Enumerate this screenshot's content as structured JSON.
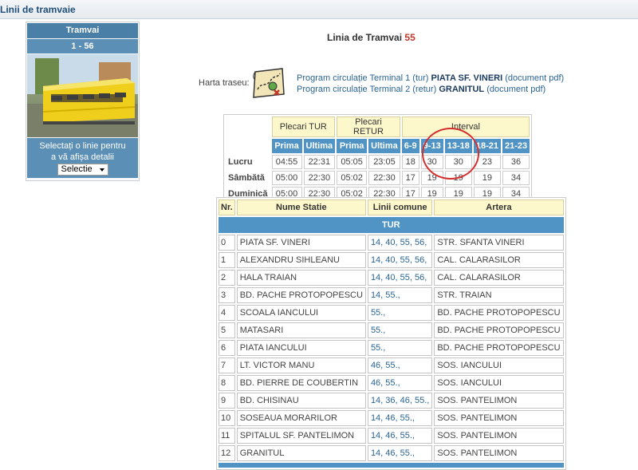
{
  "page": {
    "title": "Linii de tramvaie"
  },
  "sidebar": {
    "header": "Tramvai",
    "range": "1 - 56",
    "select_prompt_line1": "Selectați o linie pentru",
    "select_prompt_line2": "a vă afișa detalii",
    "select_value": "Selectie"
  },
  "main": {
    "line_prefix": "Linia de Tramvai",
    "line_number": "55",
    "map_label": "Harta traseu:",
    "program1": {
      "prefix": "Program circulație Terminal 1 (tur)",
      "terminal": "PIATA SF. VINERI",
      "suffix": "(document pdf)"
    },
    "program2": {
      "prefix": "Program circulație Terminal 2 (retur)",
      "terminal": "GRANITUL",
      "suffix": "(document pdf)"
    }
  },
  "schedule": {
    "group_headers": [
      "Plecari TUR",
      "Plecari RETUR",
      "Interval"
    ],
    "sub_headers": [
      "Prima",
      "Ultima",
      "Prima",
      "Ultima",
      "6-9",
      "9-13",
      "13-18",
      "18-21",
      "21-23"
    ],
    "rows": [
      {
        "day": "Lucru",
        "cells": [
          "04:55",
          "22:31",
          "05:05",
          "23:05",
          "18",
          "30",
          "30",
          "23",
          "36"
        ]
      },
      {
        "day": "Sâmbătă",
        "cells": [
          "05:00",
          "22:30",
          "05:02",
          "22:30",
          "17",
          "19",
          "19",
          "19",
          "34"
        ]
      },
      {
        "day": "Duminică",
        "cells": [
          "05:00",
          "22:30",
          "05:02",
          "22:30",
          "17",
          "19",
          "19",
          "19",
          "34"
        ]
      }
    ],
    "highlight_color": "#d32f2f"
  },
  "stations": {
    "headers": [
      "Nr.",
      "Nume Statie",
      "Linii comune",
      "Artera"
    ],
    "section": "TUR",
    "rows": [
      {
        "nr": "0",
        "name": "PIATA SF. VINERI",
        "lines": "14, 40, 55, 56,",
        "artery": "STR. SFANTA VINERI"
      },
      {
        "nr": "1",
        "name": "ALEXANDRU SIHLEANU",
        "lines": "14, 40, 55, 56,",
        "artery": "CAL. CALARASILOR"
      },
      {
        "nr": "2",
        "name": "HALA TRAIAN",
        "lines": "14, 40, 55, 56,",
        "artery": "CAL. CALARASILOR"
      },
      {
        "nr": "3",
        "name": "BD. PACHE PROTOPOPESCU",
        "lines": "14, 55.,",
        "artery": "STR. TRAIAN"
      },
      {
        "nr": "4",
        "name": "SCOALA IANCULUI",
        "lines": "55.,",
        "artery": "BD. PACHE PROTOPOPESCU"
      },
      {
        "nr": "5",
        "name": "MATASARI",
        "lines": "55.,",
        "artery": "BD. PACHE PROTOPOPESCU"
      },
      {
        "nr": "6",
        "name": "PIATA IANCULUI",
        "lines": "55.,",
        "artery": "BD. PACHE PROTOPOPESCU"
      },
      {
        "nr": "7",
        "name": "LT. VICTOR MANU",
        "lines": "46, 55.,",
        "artery": "SOS. IANCULUI"
      },
      {
        "nr": "8",
        "name": "BD. PIERRE DE COUBERTIN",
        "lines": "46, 55.,",
        "artery": "SOS. IANCULUI"
      },
      {
        "nr": "9",
        "name": "BD. CHISINAU",
        "lines": "14, 36, 46, 55.,",
        "artery": "SOS. PANTELIMON"
      },
      {
        "nr": "10",
        "name": "SOSEAUA MORARILOR",
        "lines": "14, 46, 55.,",
        "artery": "SOS. PANTELIMON"
      },
      {
        "nr": "11",
        "name": "SPITALUL SF. PANTELIMON",
        "lines": "14, 46, 55.,",
        "artery": "SOS. PANTELIMON"
      },
      {
        "nr": "12",
        "name": "GRANITUL",
        "lines": "14, 46, 55.,",
        "artery": "SOS. PANTELIMON"
      }
    ]
  }
}
